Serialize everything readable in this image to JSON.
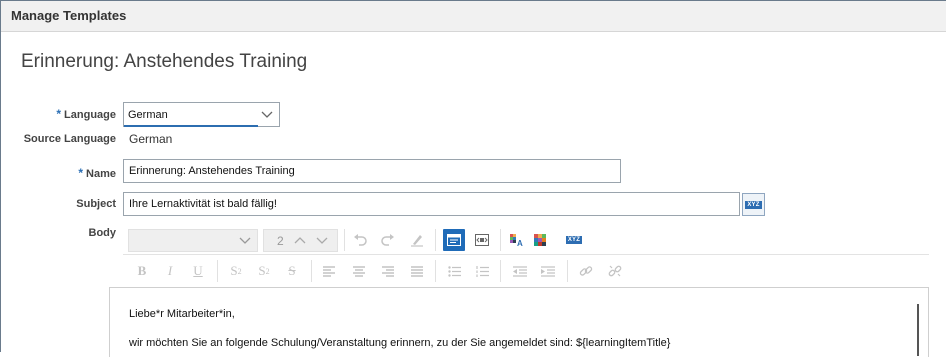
{
  "window": {
    "title": "Manage Templates"
  },
  "page": {
    "title": "Erinnerung: Anstehendes Training"
  },
  "form": {
    "language": {
      "label": "Language",
      "required_mark": "*",
      "value": "German"
    },
    "source_language": {
      "label": "Source Language",
      "value": "German"
    },
    "name": {
      "label": "Name",
      "required_mark": "*",
      "value": "Erinnerung: Anstehendes Training"
    },
    "subject": {
      "label": "Subject",
      "value": "Ihre Lernaktivität ist bald fällig!",
      "insert_button_label": "XYZ"
    },
    "body": {
      "label": "Body"
    }
  },
  "toolbar": {
    "font_family": "",
    "font_size": "2",
    "row1_icons": [
      "undo-icon",
      "redo-icon",
      "clear-format-icon",
      "source-view-icon",
      "preview-icon",
      "text-color-icon",
      "bg-color-icon",
      "insert-variable-icon"
    ],
    "row2_icons": [
      "bold-icon",
      "italic-icon",
      "underline-icon",
      "subscript-icon",
      "superscript-icon",
      "strikethrough-icon",
      "align-left-icon",
      "align-center-icon",
      "align-right-icon",
      "justify-icon",
      "bulleted-list-icon",
      "numbered-list-icon",
      "outdent-icon",
      "indent-icon",
      "link-icon",
      "unlink-icon"
    ],
    "insert_variable_label": "XYZ"
  },
  "editor": {
    "lines": [
      "Liebe*r Mitarbeiter*in,",
      "wir möchten Sie an folgende Schulung/Veranstaltung erinnern, zu der Sie angemeldet sind: ${learningItemTitle}"
    ]
  },
  "colors": {
    "accent": "#1f6bb8",
    "required": "#2b6fb5"
  }
}
